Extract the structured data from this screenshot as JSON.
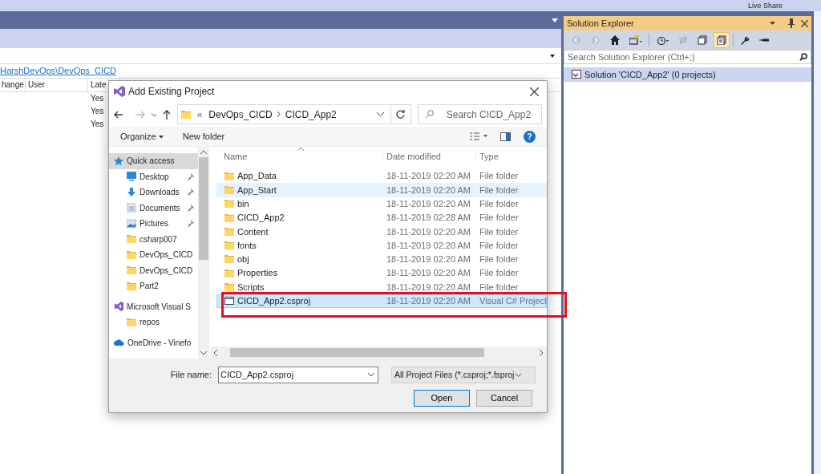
{
  "top_bar": {
    "live_share": "Live Share"
  },
  "source_control": {
    "path_link": "HarshDevOps\\DevOps_CICD",
    "columns": [
      "hange",
      "User",
      "Late"
    ],
    "rows": [
      [
        "",
        "",
        "Yes"
      ],
      [
        "",
        "",
        "Yes"
      ],
      [
        "",
        "",
        "Yes"
      ]
    ]
  },
  "solution_explorer": {
    "title": "Solution Explorer",
    "toolbar": [
      {
        "kind": "back",
        "selected": false
      },
      {
        "kind": "forward",
        "selected": false
      },
      {
        "kind": "home",
        "selected": false
      },
      {
        "kind": "switch-views",
        "selected": false
      },
      {
        "kind": "history",
        "selected": false
      },
      {
        "kind": "sync",
        "selected": false
      },
      {
        "kind": "collapse",
        "selected": false
      },
      {
        "kind": "show-all",
        "selected": true
      },
      {
        "kind": "properties",
        "selected": false
      },
      {
        "kind": "preview",
        "selected": false
      }
    ],
    "search": {
      "placeholder": "Search Solution Explorer (Ctrl+;)"
    },
    "tree": [
      {
        "label": "Solution 'CICD_App2' (0 projects)",
        "selected": true
      }
    ]
  },
  "dialog": {
    "title": "Add Existing Project",
    "address": {
      "overflow": "«",
      "crumbs": [
        "DevOps_CICD",
        "CICD_App2"
      ]
    },
    "search": {
      "placeholder": "Search CICD_App2"
    },
    "toolbar": {
      "organize": "Organize",
      "new_folder": "New folder",
      "help": "?"
    },
    "nav": [
      {
        "kind": "star",
        "label": "Quick access",
        "pinned": false,
        "selected": true
      },
      {
        "kind": "desktop",
        "label": "Desktop",
        "pinned": true,
        "selected": false
      },
      {
        "kind": "download",
        "label": "Downloads",
        "pinned": true,
        "selected": false
      },
      {
        "kind": "document",
        "label": "Documents",
        "pinned": true,
        "selected": false
      },
      {
        "kind": "pictures",
        "label": "Pictures",
        "pinned": true,
        "selected": false
      },
      {
        "kind": "folder",
        "label": "csharp007",
        "pinned": false,
        "selected": false
      },
      {
        "kind": "folder",
        "label": "DevOps_CICD",
        "pinned": false,
        "selected": false
      },
      {
        "kind": "folder",
        "label": "DevOps_CICD",
        "pinned": false,
        "selected": false
      },
      {
        "kind": "folder",
        "label": "Part2",
        "pinned": false,
        "selected": false
      },
      {
        "kind": "vs",
        "label": "Microsoft Visual S",
        "pinned": false,
        "selected": false
      },
      {
        "kind": "folder",
        "label": "repos",
        "pinned": false,
        "selected": false
      },
      {
        "kind": "onedrive",
        "label": "OneDrive - Vinefo",
        "pinned": false,
        "selected": false
      }
    ],
    "columns": [
      "Name",
      "Date modified",
      "Type"
    ],
    "files": [
      {
        "kind": "folder",
        "name": "App_Data",
        "date": "18-11-2019 02:20 AM",
        "type": "File folder",
        "hovered": false,
        "selected": false
      },
      {
        "kind": "folder",
        "name": "App_Start",
        "date": "18-11-2019 02:20 AM",
        "type": "File folder",
        "hovered": true,
        "selected": false
      },
      {
        "kind": "folder",
        "name": "bin",
        "date": "18-11-2019 02:20 AM",
        "type": "File folder",
        "hovered": false,
        "selected": false
      },
      {
        "kind": "folder",
        "name": "CICD_App2",
        "date": "18-11-2019 02:28 AM",
        "type": "File folder",
        "hovered": false,
        "selected": false
      },
      {
        "kind": "folder",
        "name": "Content",
        "date": "18-11-2019 02:20 AM",
        "type": "File folder",
        "hovered": false,
        "selected": false
      },
      {
        "kind": "folder",
        "name": "fonts",
        "date": "18-11-2019 02:20 AM",
        "type": "File folder",
        "hovered": false,
        "selected": false
      },
      {
        "kind": "folder",
        "name": "obj",
        "date": "18-11-2019 02:20 AM",
        "type": "File folder",
        "hovered": false,
        "selected": false
      },
      {
        "kind": "folder",
        "name": "Properties",
        "date": "18-11-2019 02:20 AM",
        "type": "File folder",
        "hovered": false,
        "selected": false
      },
      {
        "kind": "folder",
        "name": "Scripts",
        "date": "18-11-2019 02:20 AM",
        "type": "File folder",
        "hovered": false,
        "selected": false
      },
      {
        "kind": "project",
        "name": "CICD_App2.csproj",
        "date": "18-11-2019 02:20 AM",
        "type": "Visual C# Project",
        "hovered": false,
        "selected": true
      }
    ],
    "file_name": {
      "label": "File name:",
      "value": "CICD_App2.csproj"
    },
    "filter": "All Project Files (*.csproj;*.fsproj",
    "buttons": [
      {
        "label": "Open",
        "default": true
      },
      {
        "label": "Cancel",
        "default": false
      }
    ]
  },
  "annotation": {
    "kind": "highlight-box"
  }
}
